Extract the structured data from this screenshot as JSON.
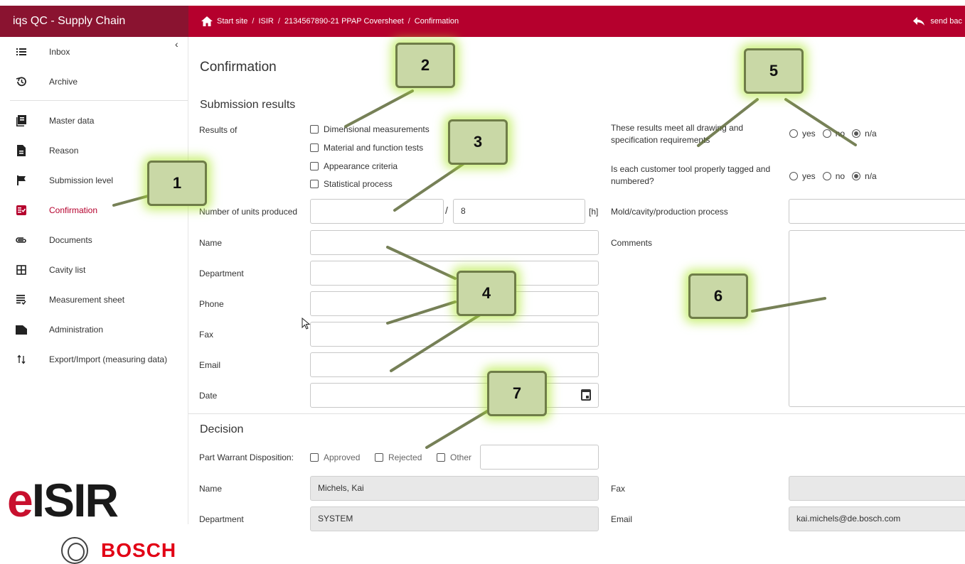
{
  "app": {
    "title": "iqs QC - Supply Chain"
  },
  "breadcrumb": {
    "items": [
      "Start site",
      "ISIR",
      "2134567890-21 PPAP Coversheet",
      "Confirmation"
    ],
    "separator": "/"
  },
  "header": {
    "send_back_label": "send bac"
  },
  "sidebar": {
    "items": [
      {
        "label": "Inbox",
        "icon": "list-icon"
      },
      {
        "label": "Archive",
        "icon": "history-icon"
      },
      {
        "label": "Master data",
        "icon": "library-icon"
      },
      {
        "label": "Reason",
        "icon": "document-icon"
      },
      {
        "label": "Submission level",
        "icon": "flag-icon"
      },
      {
        "label": "Confirmation",
        "icon": "confirm-list-icon",
        "active": true
      },
      {
        "label": "Documents",
        "icon": "paperclip-icon"
      },
      {
        "label": "Cavity list",
        "icon": "grid-icon"
      },
      {
        "label": "Measurement sheet",
        "icon": "sheet-icon"
      },
      {
        "label": "Administration",
        "icon": "folder-icon"
      },
      {
        "label": "Export/Import (measuring data)",
        "icon": "import-export-icon"
      }
    ]
  },
  "logo": {
    "prefix": "e",
    "rest": "ISIR",
    "brand": "BOSCH"
  },
  "page": {
    "title": "Confirmation"
  },
  "submission": {
    "title": "Submission results",
    "results_of_label": "Results of",
    "results_options": [
      "Dimensional measurements",
      "Material and function tests",
      "Appearance criteria",
      "Statistical process"
    ],
    "units_label": "Number of units produced",
    "units_value": "",
    "hours_value": "8",
    "hours_unit": "[h]",
    "requirements_question": "These results meet all drawing and specification requirements",
    "requirements_selected": "n/a",
    "tool_question": "Is each customer tool properly tagged and numbered?",
    "tool_selected": "n/a",
    "radio_options": [
      "yes",
      "no",
      "n/a"
    ],
    "mold_label": "Mold/cavity/production process",
    "comments_label": "Comments",
    "contact": {
      "name_label": "Name",
      "department_label": "Department",
      "phone_label": "Phone",
      "fax_label": "Fax",
      "email_label": "Email",
      "date_label": "Date"
    }
  },
  "decision": {
    "title": "Decision",
    "warrant_label": "Part Warrant Disposition:",
    "options": [
      "Approved",
      "Rejected",
      "Other"
    ],
    "name_label": "Name",
    "name_value": "Michels, Kai",
    "department_label": "Department",
    "department_value": "SYSTEM",
    "fax_label": "Fax",
    "fax_value": "",
    "email_label": "Email",
    "email_value": "kai.michels@de.bosch.com"
  },
  "callouts": [
    "1",
    "2",
    "3",
    "4",
    "5",
    "6",
    "7"
  ],
  "colors": {
    "brand": "#b5002d",
    "brand_dark": "#8a1330",
    "callout_fill": "#c9d8a6",
    "callout_glow": "#aae628"
  }
}
